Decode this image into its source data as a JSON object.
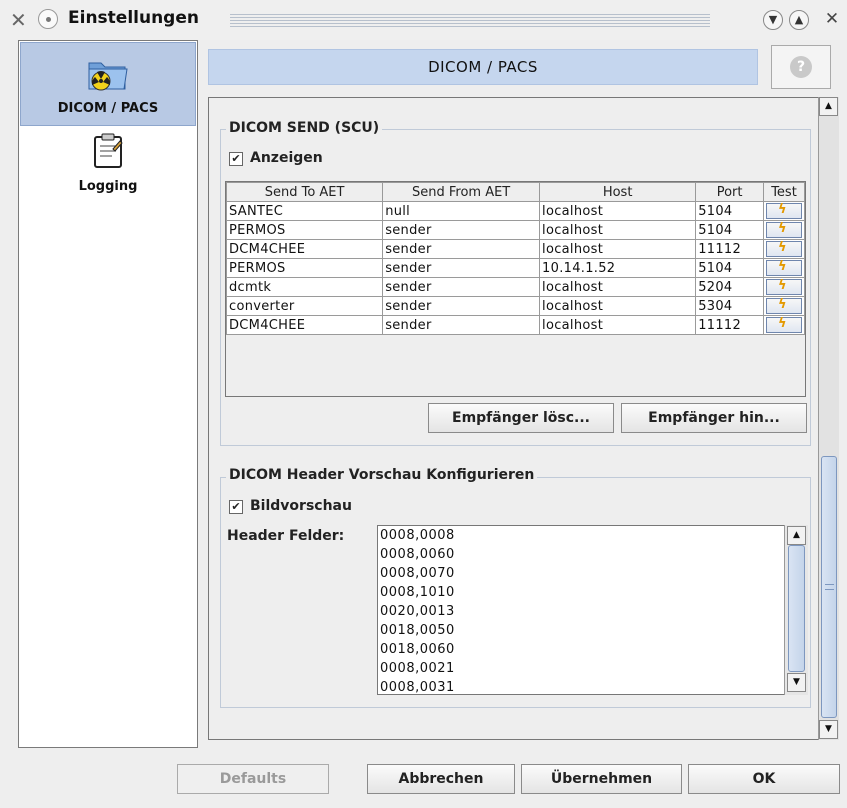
{
  "window": {
    "title": "Einstellungen"
  },
  "sidebar": {
    "items": [
      {
        "label": "DICOM / PACS",
        "icon": "radiology-folder-icon"
      },
      {
        "label": "Logging",
        "icon": "clipboard-icon"
      }
    ]
  },
  "header": {
    "title": "DICOM / PACS",
    "help_icon": "?"
  },
  "dicom_send": {
    "group_title": "DICOM SEND (SCU)",
    "show_label": "Anzeigen",
    "show_checked": true,
    "columns": [
      "Send To AET",
      "Send From AET",
      "Host",
      "Port",
      "Test"
    ],
    "rows": [
      [
        "SANTEC",
        "null",
        "localhost",
        "5104"
      ],
      [
        "PERMOS",
        "sender",
        "localhost",
        "5104"
      ],
      [
        "DCM4CHEE",
        "sender",
        "localhost",
        "11112"
      ],
      [
        "PERMOS",
        "sender",
        "10.14.1.52",
        "5104"
      ],
      [
        "dcmtk",
        "sender",
        "localhost",
        "5204"
      ],
      [
        "converter",
        "sender",
        "localhost",
        "5304"
      ],
      [
        "DCM4CHEE",
        "sender",
        "localhost",
        "11112"
      ]
    ],
    "delete_button": "Empfänger lösc...",
    "add_button": "Empfänger hin..."
  },
  "header_preview": {
    "group_title": "DICOM Header Vorschau Konfigurieren",
    "preview_label": "Bildvorschau",
    "preview_checked": true,
    "fields_label": "Header Felder:",
    "fields": [
      "0008,0008",
      "0008,0060",
      "0008,0070",
      "0008,1010",
      "0020,0013",
      "0018,0050",
      "0018,0060",
      "0008,0021",
      "0008,0031"
    ]
  },
  "footer": {
    "defaults": "Defaults",
    "cancel": "Abbrechen",
    "apply": "Übernehmen",
    "ok": "OK"
  },
  "colors": {
    "selection": "#b8c9e4",
    "header_bg": "#c5d6ee",
    "test_icon": "#e39900"
  }
}
